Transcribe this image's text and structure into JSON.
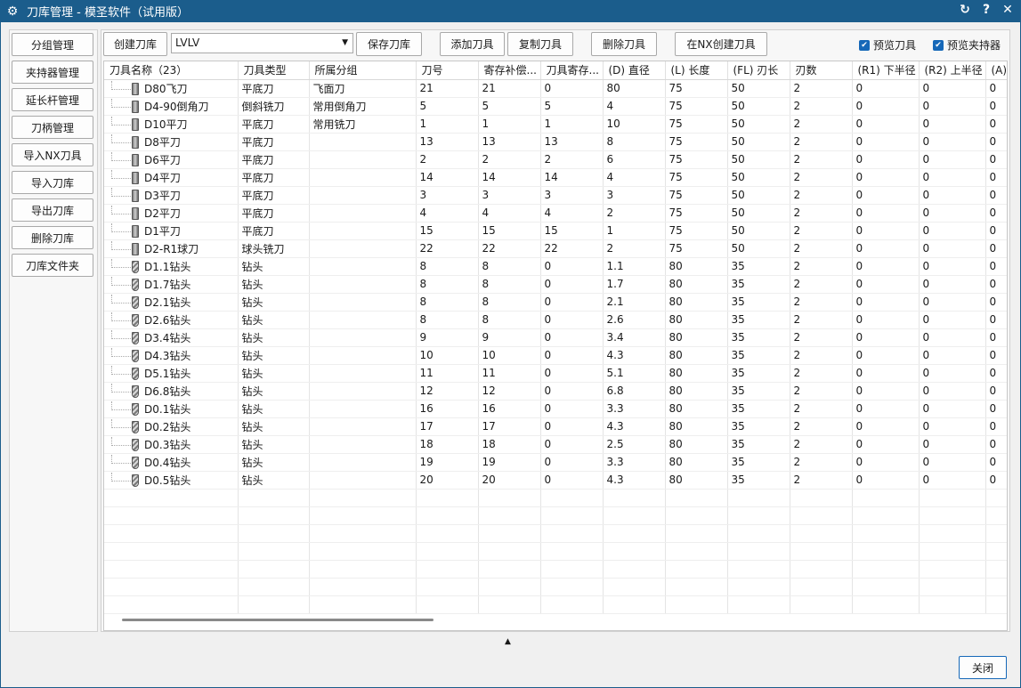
{
  "window": {
    "title": "刀库管理 - 模圣软件（试用版）",
    "icon": "gear-icon",
    "controls": [
      "refresh-icon",
      "help-icon",
      "close-icon"
    ]
  },
  "sidebar": {
    "items": [
      "分组管理",
      "夹持器管理",
      "延长杆管理",
      "刀柄管理",
      "导入NX刀具",
      "导入刀库",
      "导出刀库",
      "删除刀库",
      "刀库文件夹"
    ]
  },
  "toolbar": {
    "create_library": "创建刀库",
    "library_select": "LVLV",
    "save_library": "保存刀库",
    "add_tool": "添加刀具",
    "copy_tool": "复制刀具",
    "delete_tool": "删除刀具",
    "create_in_nx": "在NX创建刀具",
    "preview_tool": "预览刀具",
    "preview_holder": "预览夹持器"
  },
  "table": {
    "columns": [
      "刀具名称（23）",
      "刀具类型",
      "所属分组",
      "刀号",
      "寄存补偿...",
      "刀具寄存...",
      "(D) 直径",
      "(L) 长度",
      "(FL) 刃长",
      "刃数",
      "(R1) 下半径",
      "(R2) 上半径",
      "(A)"
    ],
    "rows": [
      {
        "icon": "endmill",
        "cells": [
          "D80飞刀",
          "平底刀",
          "飞面刀",
          "21",
          "21",
          "0",
          "80",
          "75",
          "50",
          "2",
          "0",
          "0",
          "0"
        ]
      },
      {
        "icon": "endmill",
        "cells": [
          "D4-90倒角刀",
          "倒斜铣刀",
          "常用倒角刀",
          "5",
          "5",
          "5",
          "4",
          "75",
          "50",
          "2",
          "0",
          "0",
          "0"
        ]
      },
      {
        "icon": "endmill",
        "cells": [
          "D10平刀",
          "平底刀",
          "常用铣刀",
          "1",
          "1",
          "1",
          "10",
          "75",
          "50",
          "2",
          "0",
          "0",
          "0"
        ]
      },
      {
        "icon": "endmill",
        "cells": [
          "D8平刀",
          "平底刀",
          "",
          "13",
          "13",
          "13",
          "8",
          "75",
          "50",
          "2",
          "0",
          "0",
          "0"
        ]
      },
      {
        "icon": "endmill",
        "cells": [
          "D6平刀",
          "平底刀",
          "",
          "2",
          "2",
          "2",
          "6",
          "75",
          "50",
          "2",
          "0",
          "0",
          "0"
        ]
      },
      {
        "icon": "endmill",
        "cells": [
          "D4平刀",
          "平底刀",
          "",
          "14",
          "14",
          "14",
          "4",
          "75",
          "50",
          "2",
          "0",
          "0",
          "0"
        ]
      },
      {
        "icon": "endmill",
        "cells": [
          "D3平刀",
          "平底刀",
          "",
          "3",
          "3",
          "3",
          "3",
          "75",
          "50",
          "2",
          "0",
          "0",
          "0"
        ]
      },
      {
        "icon": "endmill",
        "cells": [
          "D2平刀",
          "平底刀",
          "",
          "4",
          "4",
          "4",
          "2",
          "75",
          "50",
          "2",
          "0",
          "0",
          "0"
        ]
      },
      {
        "icon": "endmill",
        "cells": [
          "D1平刀",
          "平底刀",
          "",
          "15",
          "15",
          "15",
          "1",
          "75",
          "50",
          "2",
          "0",
          "0",
          "0"
        ]
      },
      {
        "icon": "endmill",
        "cells": [
          "D2-R1球刀",
          "球头铣刀",
          "",
          "22",
          "22",
          "22",
          "2",
          "75",
          "50",
          "2",
          "0",
          "0",
          "0"
        ]
      },
      {
        "icon": "drill",
        "cells": [
          "D1.1钻头",
          "钻头",
          "",
          "8",
          "8",
          "0",
          "1.1",
          "80",
          "35",
          "2",
          "0",
          "0",
          "0"
        ]
      },
      {
        "icon": "drill",
        "cells": [
          "D1.7钻头",
          "钻头",
          "",
          "8",
          "8",
          "0",
          "1.7",
          "80",
          "35",
          "2",
          "0",
          "0",
          "0"
        ]
      },
      {
        "icon": "drill",
        "cells": [
          "D2.1钻头",
          "钻头",
          "",
          "8",
          "8",
          "0",
          "2.1",
          "80",
          "35",
          "2",
          "0",
          "0",
          "0"
        ]
      },
      {
        "icon": "drill",
        "cells": [
          "D2.6钻头",
          "钻头",
          "",
          "8",
          "8",
          "0",
          "2.6",
          "80",
          "35",
          "2",
          "0",
          "0",
          "0"
        ]
      },
      {
        "icon": "drill",
        "cells": [
          "D3.4钻头",
          "钻头",
          "",
          "9",
          "9",
          "0",
          "3.4",
          "80",
          "35",
          "2",
          "0",
          "0",
          "0"
        ]
      },
      {
        "icon": "drill",
        "cells": [
          "D4.3钻头",
          "钻头",
          "",
          "10",
          "10",
          "0",
          "4.3",
          "80",
          "35",
          "2",
          "0",
          "0",
          "0"
        ]
      },
      {
        "icon": "drill",
        "cells": [
          "D5.1钻头",
          "钻头",
          "",
          "11",
          "11",
          "0",
          "5.1",
          "80",
          "35",
          "2",
          "0",
          "0",
          "0"
        ]
      },
      {
        "icon": "drill",
        "cells": [
          "D6.8钻头",
          "钻头",
          "",
          "12",
          "12",
          "0",
          "6.8",
          "80",
          "35",
          "2",
          "0",
          "0",
          "0"
        ]
      },
      {
        "icon": "drill",
        "cells": [
          "D0.1钻头",
          "钻头",
          "",
          "16",
          "16",
          "0",
          "3.3",
          "80",
          "35",
          "2",
          "0",
          "0",
          "0"
        ]
      },
      {
        "icon": "drill",
        "cells": [
          "D0.2钻头",
          "钻头",
          "",
          "17",
          "17",
          "0",
          "4.3",
          "80",
          "35",
          "2",
          "0",
          "0",
          "0"
        ]
      },
      {
        "icon": "drill",
        "cells": [
          "D0.3钻头",
          "钻头",
          "",
          "18",
          "18",
          "0",
          "2.5",
          "80",
          "35",
          "2",
          "0",
          "0",
          "0"
        ]
      },
      {
        "icon": "drill",
        "cells": [
          "D0.4钻头",
          "钻头",
          "",
          "19",
          "19",
          "0",
          "3.3",
          "80",
          "35",
          "2",
          "0",
          "0",
          "0"
        ]
      },
      {
        "icon": "drill",
        "cells": [
          "D0.5钻头",
          "钻头",
          "",
          "20",
          "20",
          "0",
          "4.3",
          "80",
          "35",
          "2",
          "0",
          "0",
          "0"
        ]
      }
    ]
  },
  "footer": {
    "close": "关闭"
  },
  "colors": {
    "titlebar": "#1b5d8c",
    "accent": "#1668b8"
  }
}
